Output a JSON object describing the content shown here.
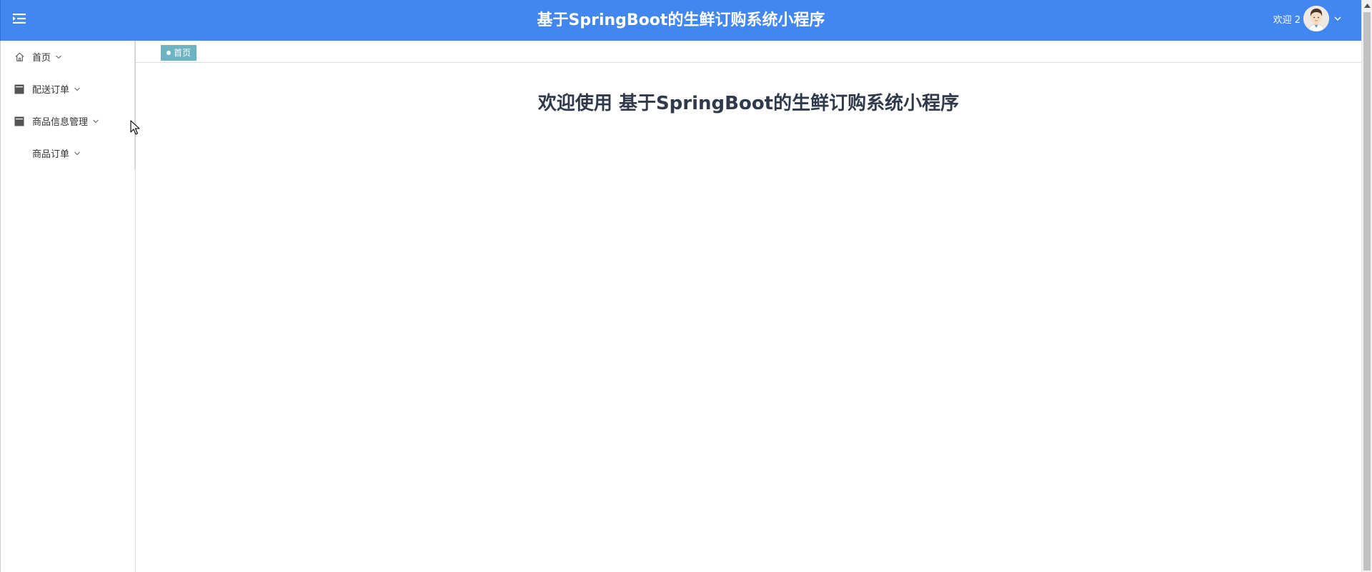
{
  "header": {
    "title": "基于SpringBoot的生鲜订购系统小程序",
    "welcome": "欢迎 2",
    "menu_icon": "menu-fold-icon",
    "avatar_icon": "user-avatar",
    "background_color": "#4287ef"
  },
  "sidebar": {
    "items": [
      {
        "label": "首页",
        "icon": "home-icon"
      },
      {
        "label": "配送订单",
        "icon": "document-icon"
      },
      {
        "label": "商品信息管理",
        "icon": "document-icon"
      },
      {
        "label": "商品订单",
        "icon": ""
      }
    ]
  },
  "tabs": [
    {
      "label": "首页",
      "active": true,
      "color": "#6db3c3"
    }
  ],
  "main": {
    "heading": "欢迎使用 基于SpringBoot的生鲜订购系统小程序"
  }
}
